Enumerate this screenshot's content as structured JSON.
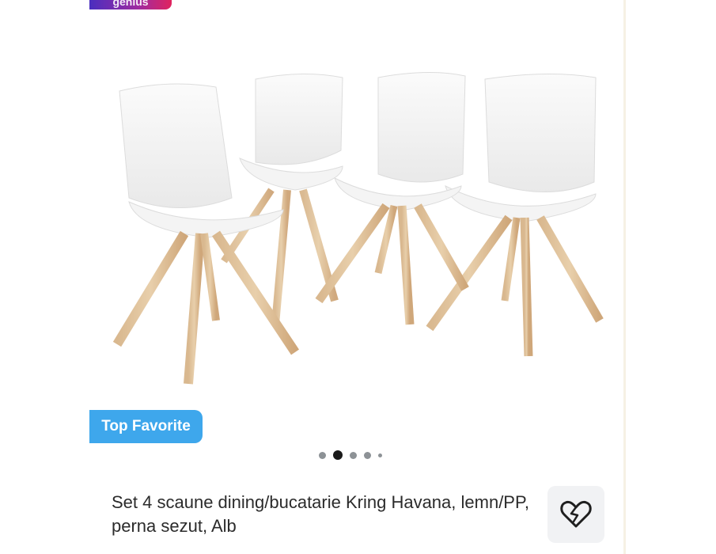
{
  "badge": {
    "genius_label": "genius"
  },
  "product": {
    "image_alt": "Set 4 white chairs with wooden legs",
    "badge_label": "Top Favorite",
    "title": "Set 4 scaune dining/bucatarie Kring Havana, lemn/PP, perna sezut, Alb"
  },
  "carousel": {
    "dot_count": 5,
    "active_index": 1
  },
  "icons": {
    "favorite": "heart-icon"
  },
  "colors": {
    "top_favorite_badge": "#3ea7ec",
    "genius_gradient_start": "#4a2fbf",
    "genius_gradient_end": "#e0245e"
  }
}
